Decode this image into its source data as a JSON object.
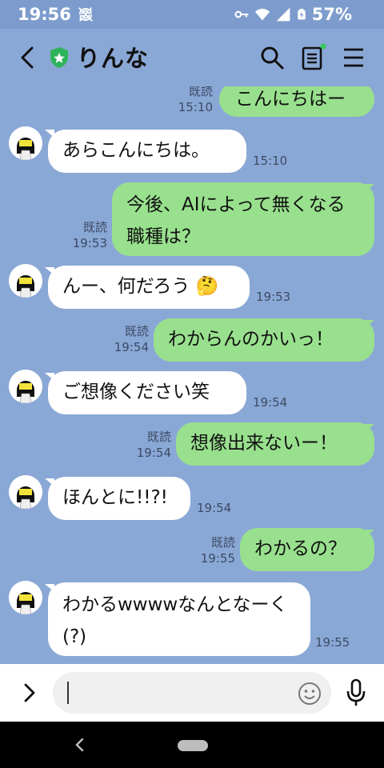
{
  "status": {
    "time": "19:56",
    "battery": "57%"
  },
  "header": {
    "title": "りんな"
  },
  "messages": [
    {
      "side": "right",
      "text": "こんにちはー",
      "read": "既読",
      "time": "15:10"
    },
    {
      "side": "left",
      "text": "あらこんにちは。",
      "time": "15:10"
    },
    {
      "side": "right",
      "text": "今後、AIによって無くなる職種は？",
      "read": "既読",
      "time": "19:53"
    },
    {
      "side": "left",
      "text": "んー、何だろう",
      "emoji": "🤔",
      "time": "19:53"
    },
    {
      "side": "right",
      "text": "わからんのかいっ！",
      "read": "既読",
      "time": "19:54"
    },
    {
      "side": "left",
      "text": "ご想像ください笑",
      "time": "19:54"
    },
    {
      "side": "right",
      "text": "想像出来ないー！",
      "read": "既読",
      "time": "19:54"
    },
    {
      "side": "left",
      "text": "ほんとに!!?!",
      "time": "19:54"
    },
    {
      "side": "right",
      "text": "わかるの？",
      "read": "既読",
      "time": "19:55"
    },
    {
      "side": "left",
      "text": "わかるwwwwなんとなーく(?)",
      "time": "19:55"
    }
  ],
  "input": {
    "value": "",
    "placeholder": ""
  },
  "colors": {
    "background": "#8aa8d6",
    "status_bar": "#7d9ccd",
    "sent_bubble": "#99e08e",
    "received_bubble": "#ffffff",
    "shield": "#2fb35a",
    "online_dot": "#38c95a"
  },
  "icons": {
    "back": "chevron-left-icon",
    "shield": "shield-star-icon",
    "search": "search-icon",
    "note": "note-icon",
    "menu": "hamburger-menu-icon",
    "expand": "chevron-right-icon",
    "emoji": "smiley-icon",
    "mic": "microphone-icon"
  }
}
